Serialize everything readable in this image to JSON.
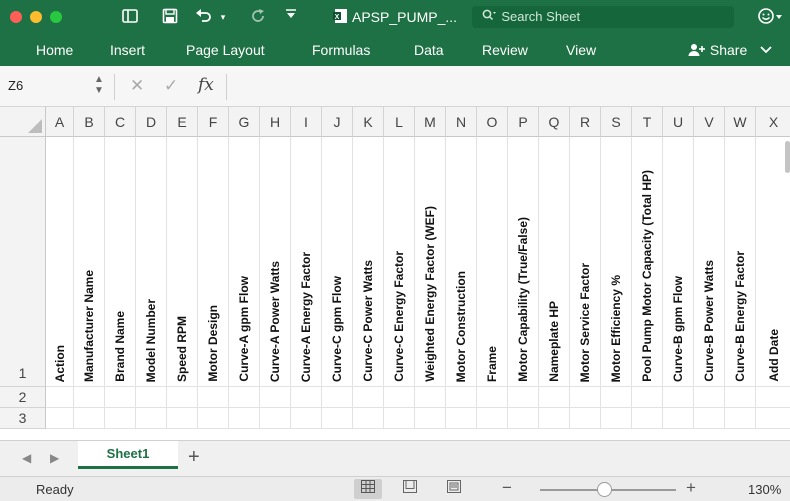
{
  "titlebar": {
    "doc_title": "APSP_PUMP_...",
    "search_placeholder": "Search Sheet",
    "colors": {
      "bar": "#1e7145",
      "close": "#ff5f57",
      "minimize": "#febc2e",
      "zoom": "#28c840"
    },
    "icons": [
      "sidebar-toggle-icon",
      "save-icon",
      "undo-icon",
      "redo-icon",
      "customize-toolbar-icon",
      "excel-doc-icon",
      "search-icon",
      "smiley-feedback-icon"
    ]
  },
  "ribbon": {
    "tabs": [
      "Home",
      "Insert",
      "Page Layout",
      "Formulas",
      "Data",
      "Review",
      "View"
    ],
    "share_label": "Share"
  },
  "formula_bar": {
    "name_box": "Z6",
    "fx_label": "fx",
    "formula": ""
  },
  "grid": {
    "columns": [
      "A",
      "B",
      "C",
      "D",
      "E",
      "F",
      "G",
      "H",
      "I",
      "J",
      "K",
      "L",
      "M",
      "N",
      "O",
      "P",
      "Q",
      "R",
      "S",
      "T",
      "U",
      "V",
      "W",
      "X"
    ],
    "rows": [
      "1",
      "2",
      "3"
    ],
    "headers": [
      "Action",
      "Manufacturer Name",
      "Brand Name",
      "Model Number",
      "Speed RPM",
      "Motor Design",
      "Curve-A gpm Flow",
      "Curve-A Power Watts",
      "Curve-A Energy Factor",
      "Curve-C gpm Flow",
      "Curve-C Power Watts",
      "Curve-C Energy Factor",
      "Weighted Energy Factor (WEF)",
      "Motor Construction",
      "Frame",
      "Motor Capability (True/False)",
      "Nameplate HP",
      "Motor Service Factor",
      "Motor Efficiency %",
      "Pool Pump Motor Capacity (Total HP)",
      "Curve-B gpm Flow",
      "Curve-B Power Watts",
      "Curve-B Energy Factor",
      "Add Date"
    ]
  },
  "sheets": {
    "tabs": [
      "Sheet1"
    ],
    "active": "Sheet1"
  },
  "statusbar": {
    "status": "Ready",
    "zoom": "130%",
    "zoom_slider_fraction": 0.47
  }
}
